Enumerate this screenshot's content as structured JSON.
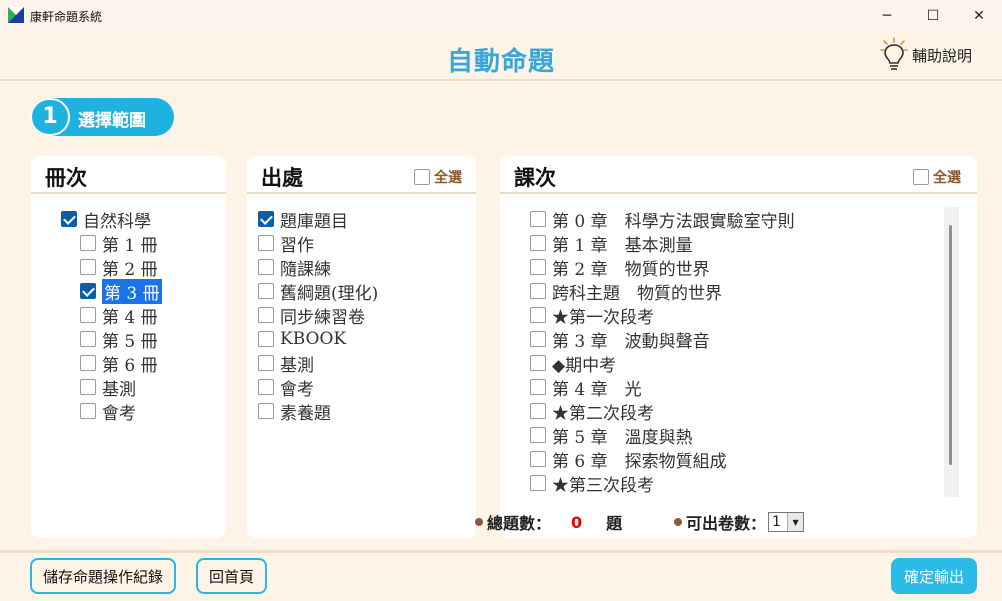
{
  "window": {
    "title": "康軒命題系統",
    "minimize": "─",
    "maximize": "☐",
    "close": "✕"
  },
  "header": {
    "title": "自動命題",
    "help_label": "輔助說明"
  },
  "step": {
    "number": "1",
    "label": "選擇範圍"
  },
  "volumes": {
    "title": "冊次",
    "items": [
      {
        "label": "自然科學",
        "checked": true,
        "indent": 0
      },
      {
        "label": "第 1 冊",
        "checked": false,
        "indent": 1
      },
      {
        "label": "第 2 冊",
        "checked": false,
        "indent": 1
      },
      {
        "label": "第 3 冊",
        "checked": true,
        "indent": 1,
        "highlighted": true
      },
      {
        "label": "第 4 冊",
        "checked": false,
        "indent": 1
      },
      {
        "label": "第 5 冊",
        "checked": false,
        "indent": 1
      },
      {
        "label": "第 6 冊",
        "checked": false,
        "indent": 1
      },
      {
        "label": "基測",
        "checked": false,
        "indent": 1
      },
      {
        "label": "會考",
        "checked": false,
        "indent": 1
      }
    ]
  },
  "sources": {
    "title": "出處",
    "select_all": "全選",
    "items": [
      {
        "label": "題庫題目",
        "checked": true
      },
      {
        "label": "習作",
        "checked": false
      },
      {
        "label": "隨課練",
        "checked": false
      },
      {
        "label": "舊綱題(理化)",
        "checked": false
      },
      {
        "label": "同步練習卷",
        "checked": false
      },
      {
        "label": "KBOOK",
        "checked": false
      },
      {
        "label": "基測",
        "checked": false
      },
      {
        "label": "會考",
        "checked": false
      },
      {
        "label": "素養題",
        "checked": false
      }
    ]
  },
  "lessons": {
    "title": "課次",
    "select_all": "全選",
    "items": [
      {
        "label": "第 0 章　科學方法跟實驗室守則",
        "checked": false
      },
      {
        "label": "第 1 章　基本測量",
        "checked": false
      },
      {
        "label": "第 2 章　物質的世界",
        "checked": false
      },
      {
        "label": "跨科主題　物質的世界",
        "checked": false
      },
      {
        "label": "★第一次段考",
        "checked": false
      },
      {
        "label": "第 3 章　波動與聲音",
        "checked": false
      },
      {
        "label": "◆期中考",
        "checked": false
      },
      {
        "label": "第 4 章　光",
        "checked": false
      },
      {
        "label": "★第二次段考",
        "checked": false
      },
      {
        "label": "第 5 章　溫度與熱",
        "checked": false
      },
      {
        "label": "第 6 章　探索物質組成",
        "checked": false
      },
      {
        "label": "★第三次段考",
        "checked": false
      }
    ]
  },
  "stats": {
    "total_label": "總題數：",
    "total_value": "0",
    "total_unit": "題",
    "copies_label": "可出卷數：",
    "copies_value": "1"
  },
  "footer": {
    "save_log": "儲存命題操作紀錄",
    "home": "回首頁",
    "confirm": "確定輸出"
  },
  "colors": {
    "accent": "#1fb2df",
    "checkbox_checked": "#0b5fa8",
    "highlight": "#1a73e8",
    "count": "#e00000"
  }
}
